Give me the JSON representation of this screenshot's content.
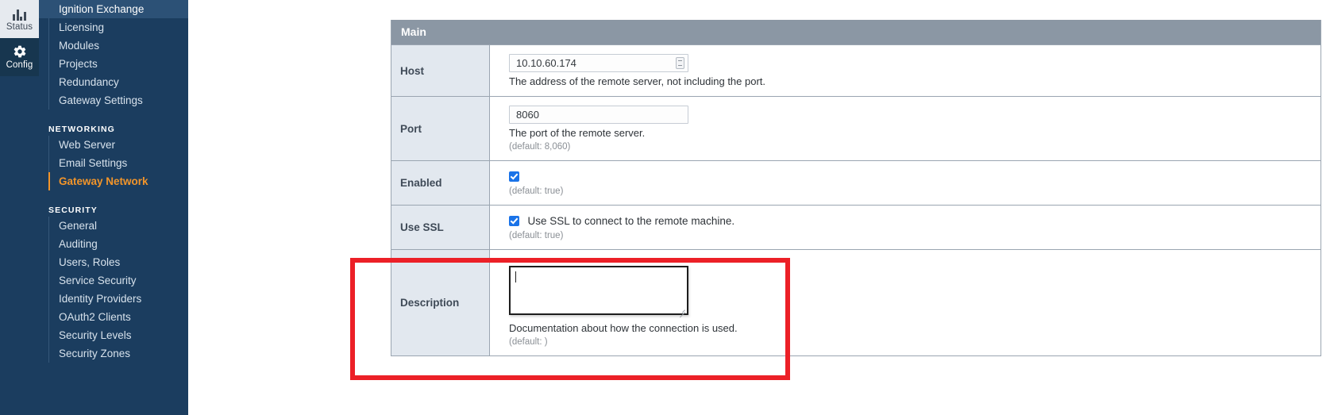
{
  "rail": {
    "items": [
      {
        "label": "Status",
        "icon": "bar-chart-icon",
        "state": "active-light"
      },
      {
        "label": "Config",
        "icon": "gear-icon",
        "state": "active-dark"
      }
    ]
  },
  "sidebar": {
    "items": [
      {
        "label": "Ignition Exchange",
        "type": "link",
        "state": "selected"
      },
      {
        "label": "Licensing",
        "type": "link",
        "state": "normal"
      },
      {
        "label": "Modules",
        "type": "link",
        "state": "normal"
      },
      {
        "label": "Projects",
        "type": "link",
        "state": "normal"
      },
      {
        "label": "Redundancy",
        "type": "link",
        "state": "normal"
      },
      {
        "label": "Gateway Settings",
        "type": "link",
        "state": "normal"
      },
      {
        "label": "NETWORKING",
        "type": "group"
      },
      {
        "label": "Web Server",
        "type": "link",
        "state": "normal"
      },
      {
        "label": "Email Settings",
        "type": "link",
        "state": "normal"
      },
      {
        "label": "Gateway Network",
        "type": "link",
        "state": "current"
      },
      {
        "label": "SECURITY",
        "type": "group"
      },
      {
        "label": "General",
        "type": "link",
        "state": "normal"
      },
      {
        "label": "Auditing",
        "type": "link",
        "state": "normal"
      },
      {
        "label": "Users, Roles",
        "type": "link",
        "state": "normal"
      },
      {
        "label": "Service Security",
        "type": "link",
        "state": "normal"
      },
      {
        "label": "Identity Providers",
        "type": "link",
        "state": "normal"
      },
      {
        "label": "OAuth2 Clients",
        "type": "link",
        "state": "normal"
      },
      {
        "label": "Security Levels",
        "type": "link",
        "state": "normal"
      },
      {
        "label": "Security Zones",
        "type": "link",
        "state": "normal"
      }
    ]
  },
  "panel": {
    "title": "Main",
    "rows": {
      "host": {
        "label": "Host",
        "value": "10.10.60.174",
        "help": "The address of the remote server, not including the port."
      },
      "port": {
        "label": "Port",
        "value": "8060",
        "help": "The port of the remote server.",
        "default": "(default: 8,060)"
      },
      "enabled": {
        "label": "Enabled",
        "checked": true,
        "default": "(default: true)"
      },
      "ssl": {
        "label": "Use SSL",
        "checked": true,
        "inline_label": "Use SSL to connect to the remote machine.",
        "default": "(default: true)"
      },
      "description": {
        "label": "Description",
        "value": "",
        "help": "Documentation about how the connection is used.",
        "default": "(default: )"
      }
    }
  },
  "annotation": {
    "highlight_color": "#ec2027",
    "target": "description-row"
  }
}
